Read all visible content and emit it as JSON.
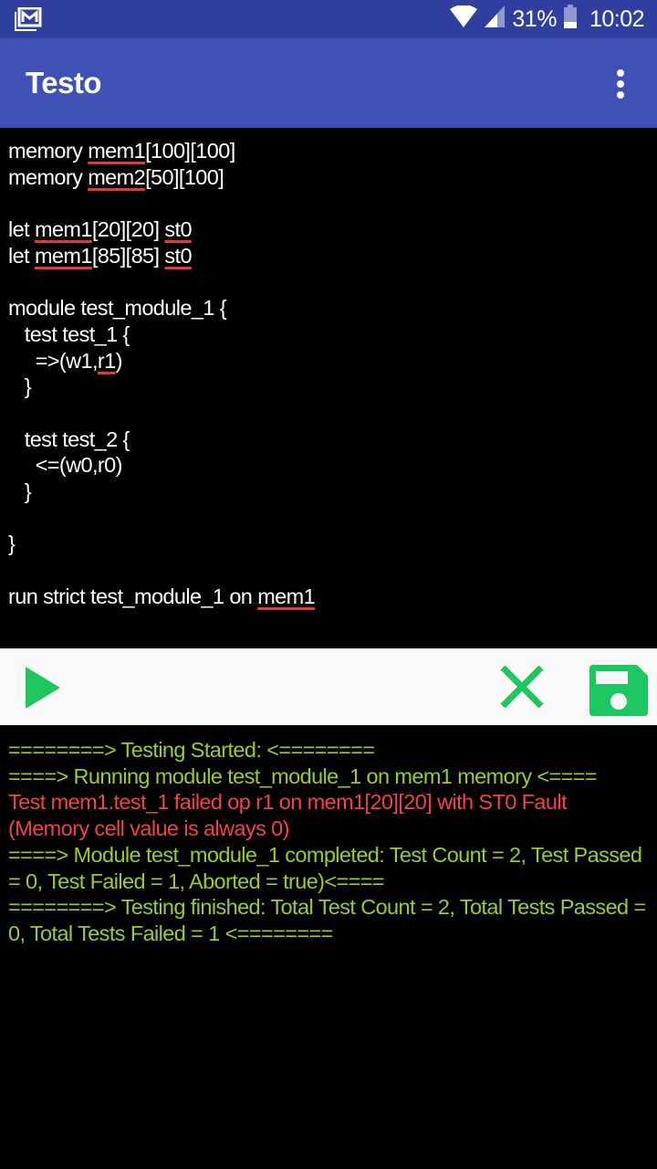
{
  "status_bar": {
    "notification_icon": "gmail-icon",
    "wifi_icon": "wifi-icon",
    "signal_icon": "cell-signal-icon",
    "battery": "31%",
    "battery_icon": "battery-icon",
    "battery_level": 0.31,
    "time": "10:02"
  },
  "app_bar": {
    "title": "Testo",
    "menu_icon": "more-vert-icon"
  },
  "editor": {
    "lines": [
      [
        {
          "t": "memory "
        },
        {
          "t": "mem1",
          "err": true
        },
        {
          "t": "[100][100]"
        }
      ],
      [
        {
          "t": "memory "
        },
        {
          "t": "mem2",
          "err": true
        },
        {
          "t": "[50][100]"
        }
      ],
      [],
      [
        {
          "t": "let "
        },
        {
          "t": "mem1",
          "err": true
        },
        {
          "t": "[20][20] "
        },
        {
          "t": "st0",
          "err": true
        }
      ],
      [
        {
          "t": "let "
        },
        {
          "t": "mem1",
          "err": true
        },
        {
          "t": "[85][85] "
        },
        {
          "t": "st0",
          "err": true
        }
      ],
      [],
      [
        {
          "t": "module test_module_1 {"
        }
      ],
      [
        {
          "t": "   test test_1 {"
        }
      ],
      [
        {
          "t": "     =>(w1,"
        },
        {
          "t": "r1",
          "err": true
        },
        {
          "t": ")"
        }
      ],
      [
        {
          "t": "   }"
        }
      ],
      [],
      [
        {
          "t": "   test test_2 {"
        }
      ],
      [
        {
          "t": "     <=(w0,r0)"
        }
      ],
      [
        {
          "t": "   }"
        }
      ],
      [],
      [
        {
          "t": "}"
        }
      ],
      [],
      [
        {
          "t": "run strict test_module_1 on "
        },
        {
          "t": "mem1",
          "err": true
        }
      ]
    ],
    "spellcheck_color": "#e53935"
  },
  "toolbar": {
    "run_icon": "play-icon",
    "clear_icon": "close-icon",
    "save_icon": "save-icon",
    "accent_color": "#1dc75f"
  },
  "output": {
    "lines": [
      {
        "text": "========> Testing Started: <========",
        "color": "#9acd32"
      },
      {
        "text": "====> Running module test_module_1 on mem1 memory <====",
        "color": "#9acd32"
      },
      {
        "text": "Test mem1.test_1 failed op r1 on mem1[20][20] with ST0 Fault (Memory cell value is always 0)",
        "color": "#f0434b"
      },
      {
        "text": "====> Module test_module_1 completed: Test Count = 2, Test Passed = 0, Test Failed = 1, Aborted = true)<====",
        "color": "#9acd32"
      },
      {
        "text": "========> Testing finished: Total Test Count = 2, Total Tests Passed = 0, Total Tests Failed = 1 <========",
        "color": "#9acd32"
      }
    ]
  }
}
